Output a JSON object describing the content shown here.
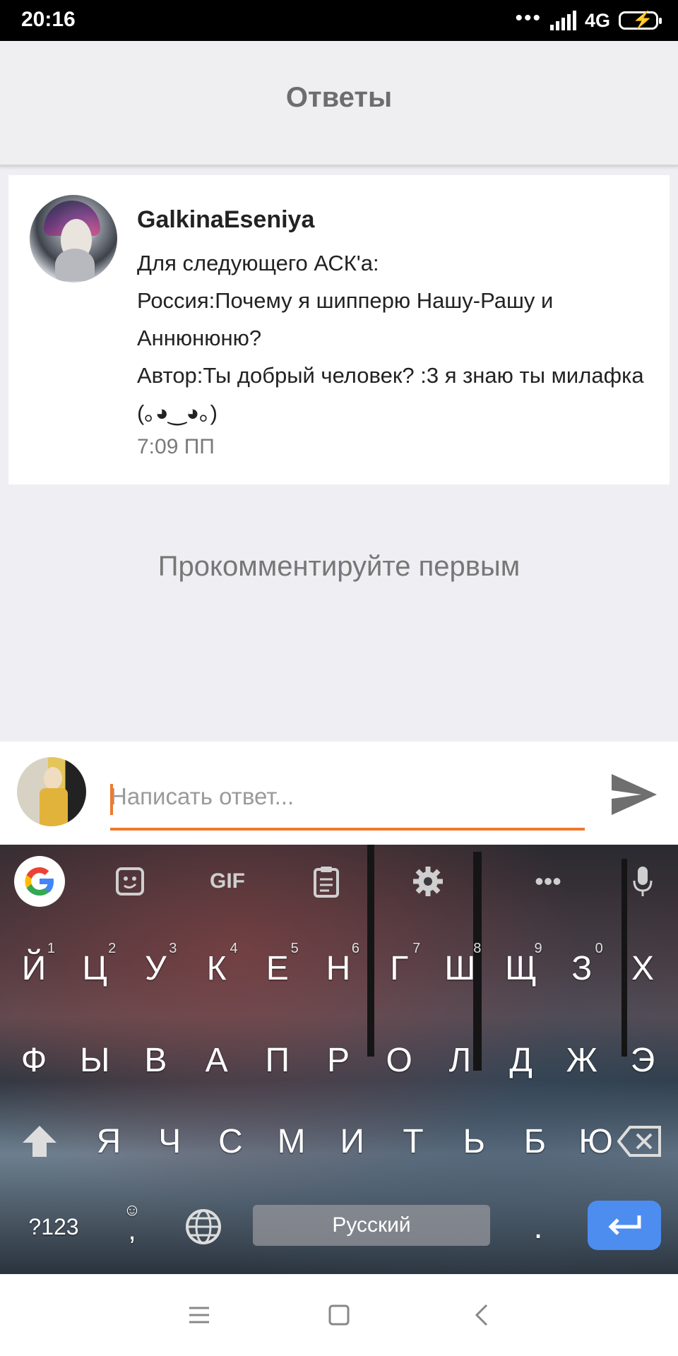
{
  "status_bar": {
    "time": "20:16",
    "dots": "•••",
    "network": "4G"
  },
  "header": {
    "title": "Ответы"
  },
  "post": {
    "author": "GalkinaEseniya",
    "lines": [
      "Для следующего АСК'а:",
      "Россия:Почему я шипперю Нашу-Рашу и Аннюнюню?",
      "Автор:Ты добрый человек? :3 я знаю ты милафка (｡◕‿◕｡)"
    ],
    "time": "7:09 ПП"
  },
  "comments": {
    "empty_text": "Прокомментируйте первым"
  },
  "composer": {
    "placeholder": "Написать ответ..."
  },
  "keyboard": {
    "toolbar": [
      "google-icon",
      "sticker-icon",
      "GIF",
      "clipboard-icon",
      "settings-icon",
      "more-icon",
      "mic-icon"
    ],
    "row1": [
      {
        "k": "Й",
        "h": "1"
      },
      {
        "k": "Ц",
        "h": "2"
      },
      {
        "k": "У",
        "h": "3"
      },
      {
        "k": "К",
        "h": "4"
      },
      {
        "k": "Е",
        "h": "5"
      },
      {
        "k": "Н",
        "h": "6"
      },
      {
        "k": "Г",
        "h": "7"
      },
      {
        "k": "Ш",
        "h": "8"
      },
      {
        "k": "Щ",
        "h": "9"
      },
      {
        "k": "З",
        "h": "0"
      },
      {
        "k": "Х",
        "h": ""
      }
    ],
    "row2": [
      "Ф",
      "Ы",
      "В",
      "А",
      "П",
      "Р",
      "О",
      "Л",
      "Д",
      "Ж",
      "Э"
    ],
    "row3": [
      "Я",
      "Ч",
      "С",
      "М",
      "И",
      "Т",
      "Ь",
      "Б",
      "Ю"
    ],
    "symbols_label": "?123",
    "comma_label": ",",
    "space_label": "Русский",
    "period_label": ".",
    "accent_color": "#4d8df0"
  },
  "colors": {
    "accent": "#ee7a30"
  }
}
